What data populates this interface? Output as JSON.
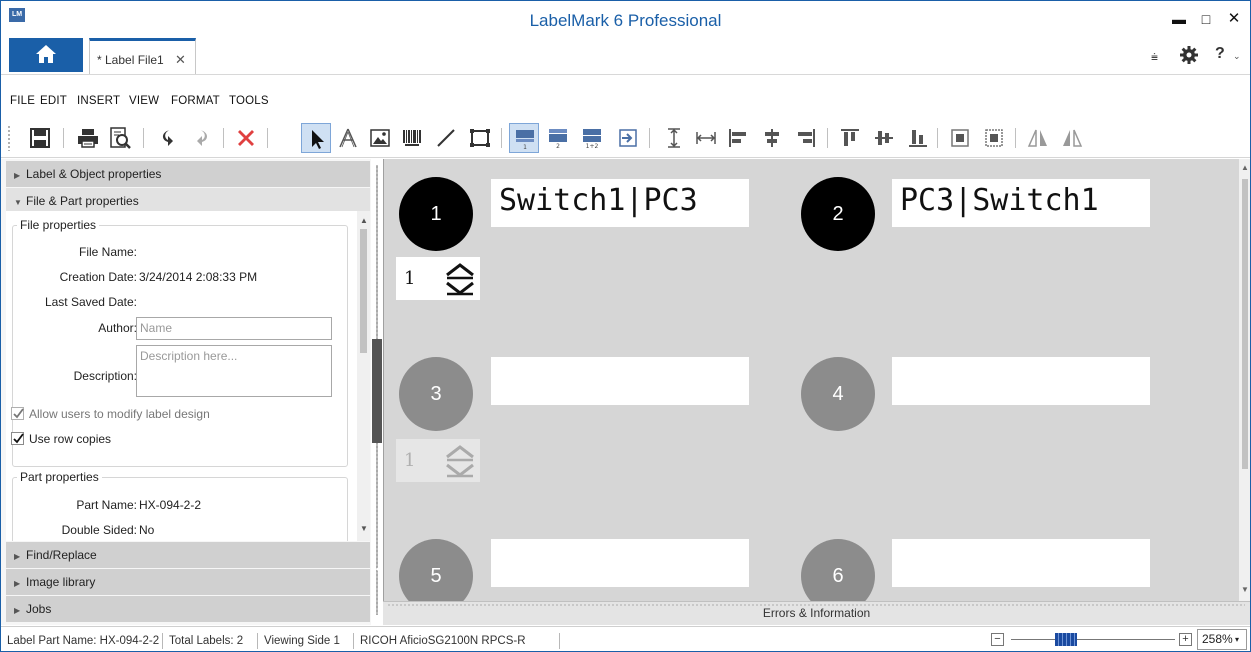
{
  "window": {
    "app_icon_text": "LM",
    "title": "LabelMark 6 Professional",
    "minimize": "▬",
    "maximize": "□",
    "close": "✕"
  },
  "tabs": {
    "doc_label": "* Label File1",
    "doc_close": "✕",
    "quick_access": "⩧",
    "help": "?",
    "help_chevron": "⌄"
  },
  "menu": {
    "file": "FILE",
    "edit": "EDIT",
    "insert": "INSERT",
    "view": "VIEW",
    "format": "FORMAT",
    "tools": "TOOLS"
  },
  "toolbar": {
    "layout_labels": {
      "side1": "1",
      "side2": "2",
      "both": "1+2"
    },
    "active_tool": "select",
    "active_layout": "side1"
  },
  "panel": {
    "sections": {
      "label_object": "Label & Object properties",
      "file_part": "File & Part properties",
      "find_replace": "Find/Replace",
      "image_library": "Image library",
      "jobs": "Jobs"
    },
    "file_properties": {
      "title": "File properties",
      "file_name_label": "File Name:",
      "file_name_value": "",
      "creation_date_label": "Creation Date:",
      "creation_date_value": "3/24/2014 2:08:33 PM",
      "last_saved_label": "Last Saved Date:",
      "last_saved_value": "",
      "author_label": "Author:",
      "author_placeholder": "Name",
      "description_label": "Description:",
      "description_placeholder": "Description here...",
      "allow_modify_label": "Allow users to modify label design",
      "allow_modify_checked": true,
      "allow_modify_disabled": true,
      "use_row_copies_label": "Use row copies",
      "use_row_copies_checked": true
    },
    "part_properties": {
      "title": "Part properties",
      "part_name_label": "Part Name:",
      "part_name_value": "HX-094-2-2",
      "double_sided_label": "Double Sided:",
      "double_sided_value": "No"
    }
  },
  "canvas": {
    "labels": [
      {
        "number": "1",
        "text": "Switch1|PC3",
        "active": true
      },
      {
        "number": "2",
        "text": "PC3|Switch1",
        "active": true
      },
      {
        "number": "3",
        "text": "",
        "active": false
      },
      {
        "number": "4",
        "text": "",
        "active": false
      },
      {
        "number": "5",
        "text": "",
        "active": false
      },
      {
        "number": "6",
        "text": "",
        "active": false
      }
    ],
    "row_copies": [
      {
        "value": "1",
        "enabled": true
      },
      {
        "value": "1",
        "enabled": false
      }
    ]
  },
  "errors_bar": "Errors & Information",
  "status": {
    "part_name": "Label Part Name:  HX-094-2-2",
    "total_labels": "Total Labels:  2",
    "viewing": "Viewing  Side 1",
    "printer": "RICOH AficioSG2100N RPCS-R",
    "zoom_out": "−",
    "zoom_in": "+",
    "zoom_level": "258%",
    "zoom_chevron": "▾"
  },
  "colors": {
    "accent": "#1a5fa8",
    "canvas_bg": "#d6d6d6",
    "active_circle": "#000000",
    "inactive_circle": "#8c8c8c",
    "delete_red": "#e04040"
  }
}
